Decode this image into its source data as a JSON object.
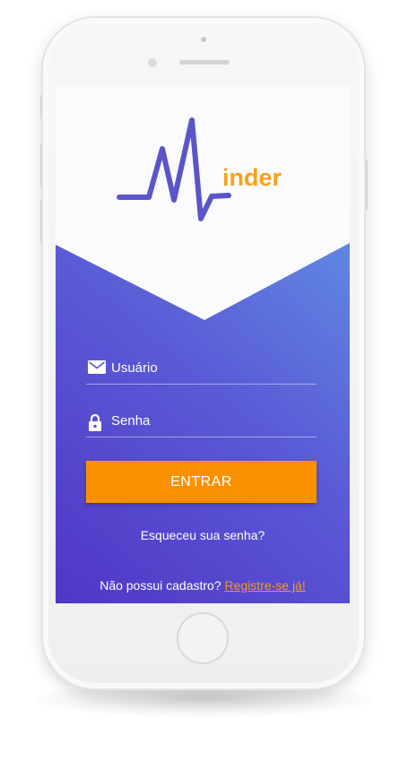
{
  "app": {
    "logo_text": "inder"
  },
  "login": {
    "username_placeholder": "Usuário",
    "password_placeholder": "Senha",
    "submit_label": "ENTRAR",
    "forgot_password": "Esqueceu sua senha?",
    "signup_prompt": "Não possui cadastro?",
    "signup_link": "Registre-se já!"
  },
  "icons": {
    "username": "mail-icon",
    "password": "lock-icon"
  },
  "colors": {
    "accent": "#fb9101",
    "logo_text": "#f7a21b",
    "logo_line": "#5b55c9",
    "gradient_start": "#5036c5",
    "gradient_end": "#63a3e8"
  }
}
